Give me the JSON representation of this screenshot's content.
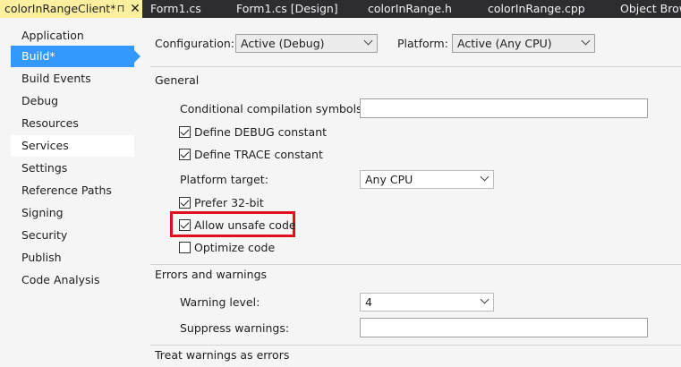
{
  "tabs": [
    {
      "label": "colorInRangeClient*",
      "active": true
    },
    {
      "label": "Form1.cs"
    },
    {
      "label": "Form1.cs [Design]"
    },
    {
      "label": "colorInRange.h"
    },
    {
      "label": "colorInRange.cpp"
    },
    {
      "label": "Object Brow"
    }
  ],
  "tab_icons": {
    "pin": "⊓",
    "close": "✕"
  },
  "nav": {
    "items": [
      "Application",
      "Build*",
      "Build Events",
      "Debug",
      "Resources",
      "Services",
      "Settings",
      "Reference Paths",
      "Signing",
      "Security",
      "Publish",
      "Code Analysis"
    ],
    "selected_index": 1,
    "hover_index": 5
  },
  "config": {
    "configuration_label": "Configuration:",
    "configuration_value": "Active (Debug)",
    "platform_label": "Platform:",
    "platform_value": "Active (Any CPU)"
  },
  "general": {
    "title": "General",
    "conditional_symbols_label": "Conditional compilation symbols:",
    "conditional_symbols_value": "",
    "define_debug_label": "Define DEBUG constant",
    "define_debug_checked": true,
    "define_trace_label": "Define TRACE constant",
    "define_trace_checked": true,
    "platform_target_label": "Platform target:",
    "platform_target_value": "Any CPU",
    "prefer32_label": "Prefer 32-bit",
    "prefer32_checked": true,
    "allow_unsafe_label": "Allow unsafe code",
    "allow_unsafe_checked": true,
    "optimize_label": "Optimize code",
    "optimize_checked": false
  },
  "errors": {
    "title": "Errors and warnings",
    "warning_level_label": "Warning level:",
    "warning_level_value": "4",
    "suppress_label": "Suppress warnings:",
    "suppress_value": ""
  },
  "treat_warnings": {
    "title": "Treat warnings as errors"
  },
  "colors": {
    "tab_strip": "#2d2d30",
    "active_tab": "#fff0a0",
    "nav_selected": "#3399ff",
    "highlight": "#e0101e"
  }
}
